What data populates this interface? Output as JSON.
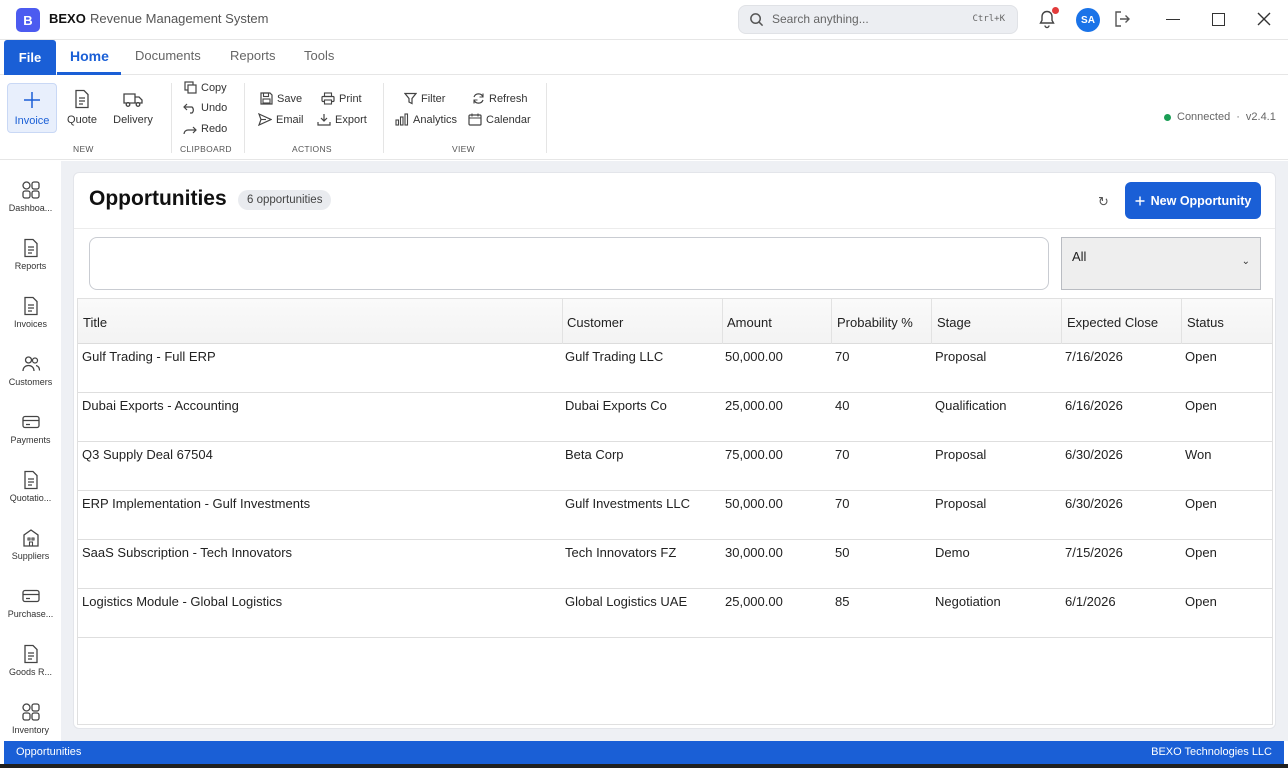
{
  "app": {
    "logo_letter": "B",
    "brand": "BEXO",
    "subtitle": "Revenue Management System",
    "search_placeholder": "Search anything...",
    "search_shortcut": "Ctrl+K",
    "avatar_initials": "SA",
    "notification_dot_color": "#e23b3b"
  },
  "ribbon_tabs": {
    "file": "File",
    "home": "Home",
    "documents": "Documents",
    "reports": "Reports",
    "tools": "Tools"
  },
  "ribbon": {
    "new_group": {
      "label": "NEW",
      "invoice": "Invoice",
      "quote": "Quote",
      "delivery": "Delivery"
    },
    "clipboard_group": {
      "label": "CLIPBOARD",
      "copy": "Copy",
      "undo": "Undo",
      "redo": "Redo"
    },
    "actions_group": {
      "label": "ACTIONS",
      "save": "Save",
      "print": "Print",
      "email": "Email",
      "export": "Export"
    },
    "view_group": {
      "label": "VIEW",
      "filter": "Filter",
      "refresh": "Refresh",
      "analytics": "Analytics",
      "calendar": "Calendar"
    },
    "connection": "Connected",
    "version_sep": "·",
    "version": "v2.4.1"
  },
  "sidebar": {
    "dashboard": "Dashboa...",
    "reports": "Reports",
    "invoices": "Invoices",
    "customers": "Customers",
    "payments": "Payments",
    "quotations": "Quotatio...",
    "suppliers": "Suppliers",
    "purchase": "Purchase...",
    "goods": "Goods R...",
    "inventory": "Inventory"
  },
  "page": {
    "title": "Opportunities",
    "count_badge": "6  opportunities",
    "refresh_glyph": "↻",
    "new_button": "New Opportunity",
    "search_value": "",
    "stage_filter": "All"
  },
  "table": {
    "columns": [
      "Title",
      "Customer",
      "Amount",
      "Probability %",
      "Stage",
      "Expected Close",
      "Status"
    ],
    "rows": [
      [
        "Gulf Trading - Full ERP",
        "Gulf Trading LLC",
        "50,000.00",
        "70",
        "Proposal",
        "7/16/2026",
        "Open"
      ],
      [
        "Dubai Exports - Accounting",
        "Dubai Exports Co",
        "25,000.00",
        "40",
        "Qualification",
        "6/16/2026",
        "Open"
      ],
      [
        "Q3 Supply Deal 67504",
        "Beta Corp",
        "75,000.00",
        "70",
        "Proposal",
        "6/30/2026",
        "Won"
      ],
      [
        "ERP Implementation - Gulf Investments",
        "Gulf Investments LLC",
        "50,000.00",
        "70",
        "Proposal",
        "6/30/2026",
        "Open"
      ],
      [
        "SaaS Subscription - Tech Innovators",
        "Tech Innovators FZ",
        "30,000.00",
        "50",
        "Demo",
        "7/15/2026",
        "Open"
      ],
      [
        "Logistics Module - Global Logistics",
        "Global Logistics UAE",
        "25,000.00",
        "85",
        "Negotiation",
        "6/1/2026",
        "Open"
      ]
    ]
  },
  "statusbar": {
    "left": "Opportunities",
    "right": "BEXO Technologies LLC"
  },
  "colors": {
    "accent": "#1a5fd6",
    "connected": "#1a9e55"
  }
}
